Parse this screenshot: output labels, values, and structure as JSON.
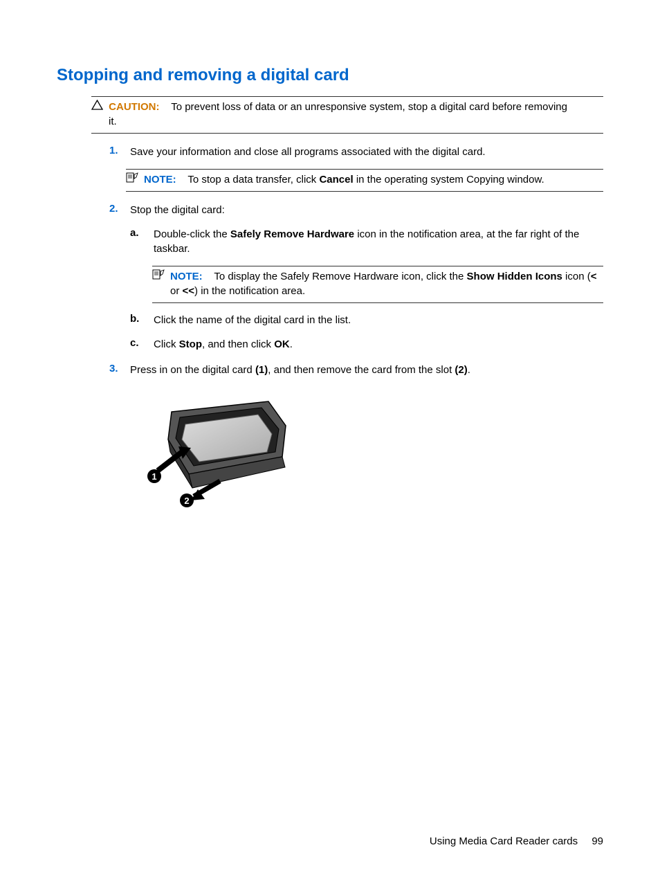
{
  "heading": "Stopping and removing a digital card",
  "caution": {
    "label": "CAUTION:",
    "text_before": "To prevent loss of data or an unresponsive system, stop a digital card before removing",
    "text_after": "it."
  },
  "steps": {
    "s1": {
      "num": "1.",
      "text": "Save your information and close all programs associated with the digital card."
    },
    "note1": {
      "label": "NOTE:",
      "text_a": "To stop a data transfer, click ",
      "bold_a": "Cancel",
      "text_b": " in the operating system Copying window."
    },
    "s2": {
      "num": "2.",
      "text": "Stop the digital card:"
    },
    "sub_a": {
      "letter": "a.",
      "t1": "Double-click the ",
      "b1": "Safely Remove Hardware",
      "t2": " icon in the notification area, at the far right of the taskbar."
    },
    "note2": {
      "label": "NOTE:",
      "t1": "To display the Safely Remove Hardware icon, click the ",
      "b1": "Show Hidden Icons",
      "t2": " icon (",
      "b2": "<",
      "t3": " or ",
      "b3": "<<",
      "t4": ") in the notification area."
    },
    "sub_b": {
      "letter": "b.",
      "text": "Click the name of the digital card in the list."
    },
    "sub_c": {
      "letter": "c.",
      "t1": "Click ",
      "b1": "Stop",
      "t2": ", and then click ",
      "b2": "OK",
      "t3": "."
    },
    "s3": {
      "num": "3.",
      "t1": "Press in on the digital card ",
      "b1": "(1)",
      "t2": ", and then remove the card from the slot ",
      "b2": "(2)",
      "t3": "."
    }
  },
  "footer": {
    "section": "Using Media Card Reader cards",
    "page": "99"
  }
}
